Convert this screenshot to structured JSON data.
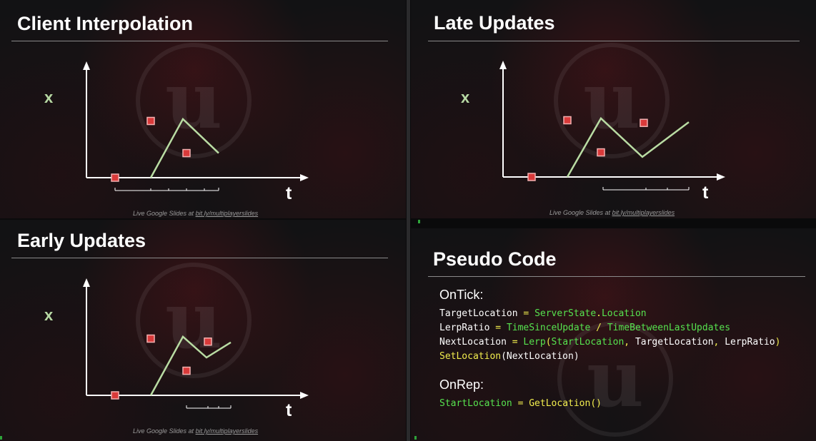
{
  "panels": [
    {
      "id": "client-interpolation",
      "title": "Client Interpolation",
      "y_label": "x",
      "t_label": "t",
      "footer_text": "Live Google Slides at ",
      "footer_link": "bit.ly/multiplayerslides",
      "chart_data": {
        "type": "line",
        "xlabel": "t",
        "ylabel": "x",
        "line": [
          [
            0,
            0
          ],
          [
            1.0,
            1.55
          ],
          [
            1.0,
            1.55
          ]
        ],
        "line_points": [
          [
            0.9,
            0
          ],
          [
            1.35,
            1.55
          ],
          [
            1.85,
            0.65
          ]
        ],
        "markers": [
          [
            0.4,
            0
          ],
          [
            0.9,
            1.5
          ],
          [
            1.4,
            0.65
          ]
        ],
        "tick_bracket": [
          0.4,
          1.85
        ],
        "tick_divisions": [
          0.9,
          1.15,
          1.4,
          1.65
        ]
      }
    },
    {
      "id": "late-updates",
      "title": "Late Updates",
      "y_label": "x",
      "t_label": "t",
      "footer_text": "Live Google Slides at ",
      "footer_link": "bit.ly/multiplayerslides",
      "chart_data": {
        "type": "line",
        "xlabel": "t",
        "ylabel": "x",
        "line_points": [
          [
            0.9,
            0
          ],
          [
            1.37,
            1.55
          ],
          [
            1.95,
            0.53
          ],
          [
            2.6,
            1.45
          ]
        ],
        "markers": [
          [
            0.4,
            0
          ],
          [
            0.9,
            1.5
          ],
          [
            1.37,
            0.65
          ],
          [
            1.97,
            1.43
          ]
        ],
        "tick_bracket": [
          1.4,
          2.6
        ],
        "tick_divisions": [
          2.0,
          2.3
        ]
      }
    },
    {
      "id": "early-updates",
      "title": "Early Updates",
      "y_label": "x",
      "t_label": "t",
      "footer_text": "Live Google Slides at ",
      "footer_link": "bit.ly/multiplayerslides",
      "chart_data": {
        "type": "line",
        "xlabel": "t",
        "ylabel": "x",
        "line_points": [
          [
            0.9,
            0
          ],
          [
            1.35,
            1.55
          ],
          [
            1.68,
            1.0
          ],
          [
            2.02,
            1.4
          ]
        ],
        "markers": [
          [
            0.4,
            0
          ],
          [
            0.9,
            1.5
          ],
          [
            1.4,
            0.65
          ],
          [
            1.7,
            1.42
          ]
        ],
        "tick_bracket": [
          1.4,
          2.02
        ],
        "tick_divisions": [
          1.7,
          1.85
        ]
      }
    }
  ],
  "pseudo": {
    "title": "Pseudo Code",
    "on_tick_label": "OnTick:",
    "on_rep_label": "OnRep:",
    "lines": [
      [
        [
          "w",
          "TargetLocation "
        ],
        [
          "y",
          "= "
        ],
        [
          "g",
          "ServerState"
        ],
        [
          "y",
          "."
        ],
        [
          "g",
          "Location"
        ]
      ],
      [
        [
          "w",
          "LerpRatio "
        ],
        [
          "y",
          "= "
        ],
        [
          "g",
          "TimeSinceUpdate "
        ],
        [
          "y",
          "/ "
        ],
        [
          "g",
          "TimeBetweenLastUpdates"
        ]
      ],
      [
        [
          "w",
          "NextLocation "
        ],
        [
          "y",
          "= "
        ],
        [
          "g",
          "Lerp"
        ],
        [
          "y",
          "("
        ],
        [
          "g",
          "StartLocation"
        ],
        [
          "y",
          ", "
        ],
        [
          "w",
          "TargetLocation"
        ],
        [
          "y",
          ", "
        ],
        [
          "w",
          "LerpRatio"
        ],
        [
          "y",
          ")"
        ]
      ],
      [
        [
          "y",
          "SetLocation"
        ],
        [
          "w",
          "(NextLocation)"
        ]
      ]
    ],
    "rep_lines": [
      [
        [
          "g",
          "StartLocation "
        ],
        [
          "y",
          "= "
        ],
        [
          "y",
          "GetLocation()"
        ]
      ]
    ]
  },
  "colors": {
    "line": "#b9dca3",
    "marker_fill": "#d93a3a",
    "marker_stroke": "#f2b0b0",
    "axis": "#ffffff",
    "code_green": "#57e34f",
    "code_yellow": "#f2ee4e"
  },
  "icons": [
    "unreal-logo-watermark"
  ]
}
